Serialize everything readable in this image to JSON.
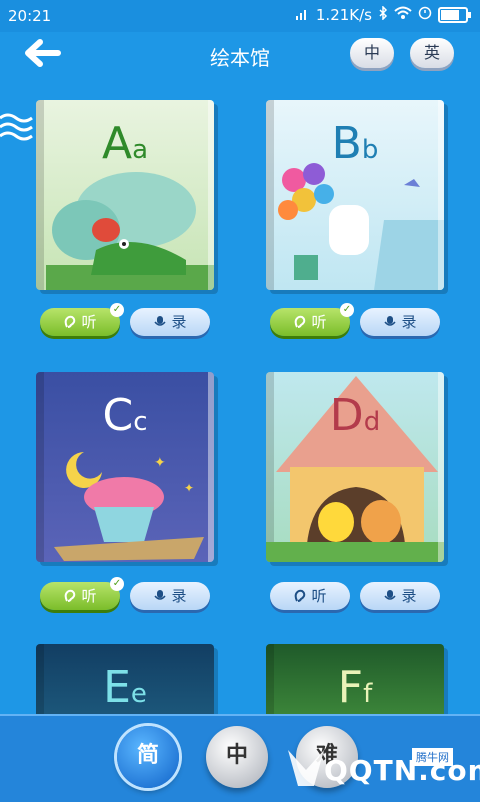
{
  "status": {
    "time": "20:21",
    "network_speed": "1.21K/s"
  },
  "header": {
    "title": "绘本馆",
    "lang_zh": "中",
    "lang_en": "英"
  },
  "books": [
    {
      "letter_upper": "A",
      "letter_lower": "a",
      "listened": true
    },
    {
      "letter_upper": "B",
      "letter_lower": "b",
      "listened": true
    },
    {
      "letter_upper": "C",
      "letter_lower": "c",
      "listened": true
    },
    {
      "letter_upper": "D",
      "letter_lower": "d",
      "listened": false
    },
    {
      "letter_upper": "E",
      "letter_lower": "e"
    },
    {
      "letter_upper": "F",
      "letter_lower": "f"
    }
  ],
  "actions": {
    "listen_label": "听",
    "record_label": "录"
  },
  "levels": {
    "easy": "简",
    "mid": "中",
    "hard": "难"
  },
  "watermark": {
    "logo": "QQTN.com",
    "site": "腾牛网"
  },
  "colors": {
    "background": "#1e97e6",
    "listen_active": "#7bbd2a",
    "level_active": "#0f62c8"
  }
}
